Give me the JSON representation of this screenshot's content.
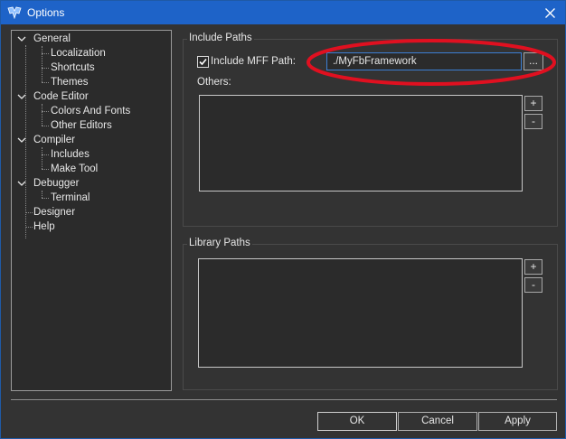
{
  "window": {
    "title": "Options"
  },
  "tree": {
    "items": [
      {
        "label": "General",
        "level": 0,
        "expanded": true
      },
      {
        "label": "Localization",
        "level": 1
      },
      {
        "label": "Shortcuts",
        "level": 1
      },
      {
        "label": "Themes",
        "level": 1
      },
      {
        "label": "Code Editor",
        "level": 0,
        "expanded": true
      },
      {
        "label": "Colors And Fonts",
        "level": 1
      },
      {
        "label": "Other Editors",
        "level": 1
      },
      {
        "label": "Compiler",
        "level": 0,
        "expanded": true
      },
      {
        "label": "Includes",
        "level": 1,
        "selected": true
      },
      {
        "label": "Make Tool",
        "level": 1
      },
      {
        "label": "Debugger",
        "level": 0,
        "expanded": true
      },
      {
        "label": "Terminal",
        "level": 1
      },
      {
        "label": "Designer",
        "level": 0
      },
      {
        "label": "Help",
        "level": 0
      }
    ]
  },
  "include_paths": {
    "title": "Include Paths",
    "mff_checkbox_label": "Include MFF Path:",
    "mff_checked": true,
    "mff_path_value": "./MyFbFramework",
    "browse_label": "...",
    "others_label": "Others:",
    "add_label": "+",
    "remove_label": "-"
  },
  "library_paths": {
    "title": "Library Paths",
    "add_label": "+",
    "remove_label": "-"
  },
  "buttons": {
    "ok": "OK",
    "cancel": "Cancel",
    "apply": "Apply"
  },
  "colors": {
    "titlebar": "#1e63c8",
    "annotation": "#e01020",
    "input_focus": "#3c7fd4"
  }
}
